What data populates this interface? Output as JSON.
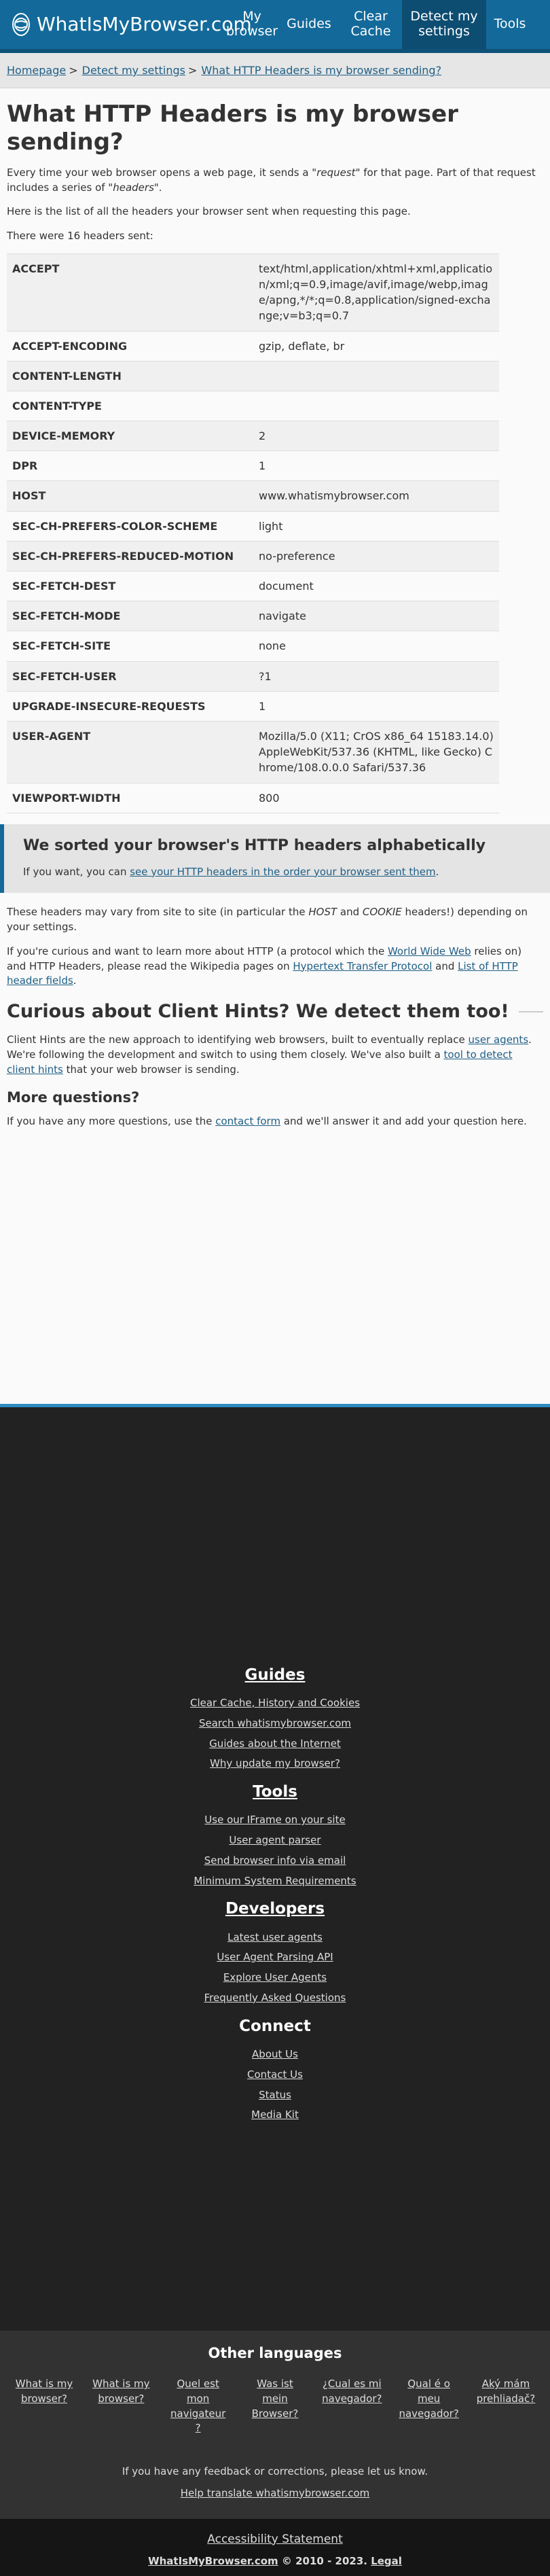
{
  "header": {
    "brand": "WhatIsMyBrowser.com",
    "nav": [
      {
        "label": "My browser",
        "active": false
      },
      {
        "label": "Guides",
        "active": false
      },
      {
        "label": "Clear Cache",
        "active": false
      },
      {
        "label": "Detect my settings",
        "active": true
      },
      {
        "label": "Tools",
        "active": false
      }
    ]
  },
  "breadcrumb": [
    "Homepage",
    "Detect my settings",
    "What HTTP Headers is my browser sending?"
  ],
  "main": {
    "title": "What HTTP Headers is my browser sending?",
    "intro_a": "Every time your web browser opens a web page, it sends a \"",
    "intro_em1": "request",
    "intro_b": "\" for that page. Part of that request includes a series of \"",
    "intro_em2": "headers",
    "intro_c": "\".",
    "list_intro": "Here is the list of all the headers your browser sent when requesting this page.",
    "count_text": "There were 16 headers sent:",
    "headers": [
      {
        "name": "ACCEPT",
        "value": "text/html,application/xhtml+xml,application/xml;q=0.9,image/avif,image/webp,image/apng,*/*;q=0.8,application/signed-exchange;v=b3;q=0.7"
      },
      {
        "name": "ACCEPT-ENCODING",
        "value": "gzip, deflate, br"
      },
      {
        "name": "CONTENT-LENGTH",
        "value": ""
      },
      {
        "name": "CONTENT-TYPE",
        "value": ""
      },
      {
        "name": "DEVICE-MEMORY",
        "value": "2"
      },
      {
        "name": "DPR",
        "value": "1"
      },
      {
        "name": "HOST",
        "value": "www.whatismybrowser.com"
      },
      {
        "name": "SEC-CH-PREFERS-COLOR-SCHEME",
        "value": "light"
      },
      {
        "name": "SEC-CH-PREFERS-REDUCED-MOTION",
        "value": "no-preference"
      },
      {
        "name": "SEC-FETCH-DEST",
        "value": "document"
      },
      {
        "name": "SEC-FETCH-MODE",
        "value": "navigate"
      },
      {
        "name": "SEC-FETCH-SITE",
        "value": "none"
      },
      {
        "name": "SEC-FETCH-USER",
        "value": "?1"
      },
      {
        "name": "UPGRADE-INSECURE-REQUESTS",
        "value": "1"
      },
      {
        "name": "USER-AGENT",
        "value": "Mozilla/5.0 (X11; CrOS x86_64 15183.14.0) AppleWebKit/537.36 (KHTML, like Gecko) Chrome/108.0.0.0 Safari/537.36"
      },
      {
        "name": "VIEWPORT-WIDTH",
        "value": "800"
      }
    ],
    "notice": {
      "title": "We sorted your browser's HTTP headers alphabetically",
      "text_a": "If you want, you can ",
      "link": "see your HTTP headers in the order your browser sent them",
      "text_b": "."
    },
    "vary_a": "These headers may vary from site to site (in particular the ",
    "vary_host": "HOST",
    "vary_b": " and ",
    "vary_cookie": "COOKIE",
    "vary_c": " headers!) depending on your settings.",
    "learn_a": "If you're curious and want to learn more about HTTP (a protocol which the ",
    "learn_link1": "World Wide Web",
    "learn_b": " relies on) and HTTP Headers, please read the Wikipedia pages on ",
    "learn_link2": "Hypertext Transfer Protocol",
    "learn_c": " and ",
    "learn_link3": "List of HTTP header fields",
    "learn_d": ".",
    "hints_title": "Curious about Client Hints? We detect them too!",
    "hints_a": "Client Hints are the new approach to identifying web browsers, built to eventually replace ",
    "hints_link1": "user agents",
    "hints_b": ". We're following the development and switch to using them closely. We've also built a ",
    "hints_link2": "tool to detect client hints",
    "hints_c": " that your web browser is sending.",
    "more_title": "More questions?",
    "more_a": "If you have any more questions, use the ",
    "more_link": "contact form",
    "more_b": " and we'll answer it and add your question here."
  },
  "footer": {
    "sections": [
      {
        "title": "Guides",
        "underline": true,
        "links": [
          "Clear Cache, History and Cookies",
          "Search whatismybrowser.com",
          "Guides about the Internet",
          "Why update my browser?"
        ]
      },
      {
        "title": "Tools",
        "underline": true,
        "links": [
          "Use our IFrame on your site",
          "User agent parser",
          "Send browser info via email",
          "Minimum System Requirements"
        ]
      },
      {
        "title": "Developers",
        "underline": true,
        "links": [
          "Latest user agents",
          "User Agent Parsing API",
          "Explore User Agents",
          "Frequently Asked Questions"
        ]
      },
      {
        "title": "Connect",
        "underline": false,
        "links": [
          "About Us",
          "Contact Us",
          "Status",
          "Media Kit"
        ]
      }
    ],
    "languages_title": "Other languages",
    "languages": [
      "What is my browser?",
      "What is my browser?",
      "Quel est mon navigateur ?",
      "Was ist mein Browser?",
      "¿Cual es mi navegador?",
      "Qual é o meu navegador?",
      "Aký mám prehliadač?"
    ],
    "feedback": "If you have any feedback or corrections, please let us know.",
    "help_link": "Help translate whatismybrowser.com",
    "accessibility": "Accessibility Statement",
    "copy_site": "WhatIsMyBrowser.com",
    "copy_mid": " © 2010 - 2023. ",
    "copy_legal": "Legal"
  }
}
